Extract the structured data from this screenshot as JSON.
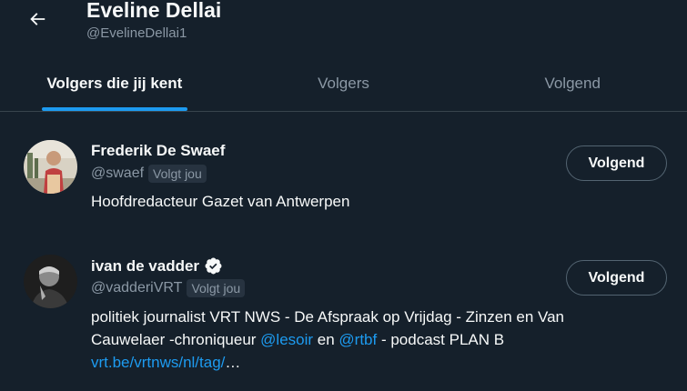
{
  "header": {
    "back_icon": "arrow-left-icon",
    "title": "Eveline Dellai",
    "handle": "@EvelineDellai1"
  },
  "tabs": [
    {
      "label": "Volgers die jij kent",
      "active": true
    },
    {
      "label": "Volgers",
      "active": false
    },
    {
      "label": "Volgend",
      "active": false
    }
  ],
  "users": [
    {
      "name": "Frederik De Swaef",
      "verified": false,
      "handle": "@swaef",
      "follows_you": "Volgt jou",
      "bio": "Hoofdredacteur Gazet van Antwerpen",
      "button": "Volgend"
    },
    {
      "name": "ivan de vadder",
      "verified": true,
      "verified_icon": "verified-badge-icon",
      "handle": "@vadderiVRT",
      "follows_you": "Volgt jou",
      "bio_parts": {
        "p1": "politiek journalist VRT NWS - De Afspraak op Vrijdag - Zinzen en Van Cauwelaer -chroniqueur ",
        "link1": "@lesoir",
        "p2": " en ",
        "link2": "@rtbf",
        "p3": " - podcast PLAN B",
        "link3": "vrt.be/vrtnws/nl/tag/",
        "ellipsis": "…"
      },
      "button": "Volgend"
    }
  ],
  "colors": {
    "background": "#15202b",
    "accent": "#1d9bf0",
    "text": "#f7f9f9",
    "secondary_text": "#8b98a5",
    "border": "#38444d"
  }
}
